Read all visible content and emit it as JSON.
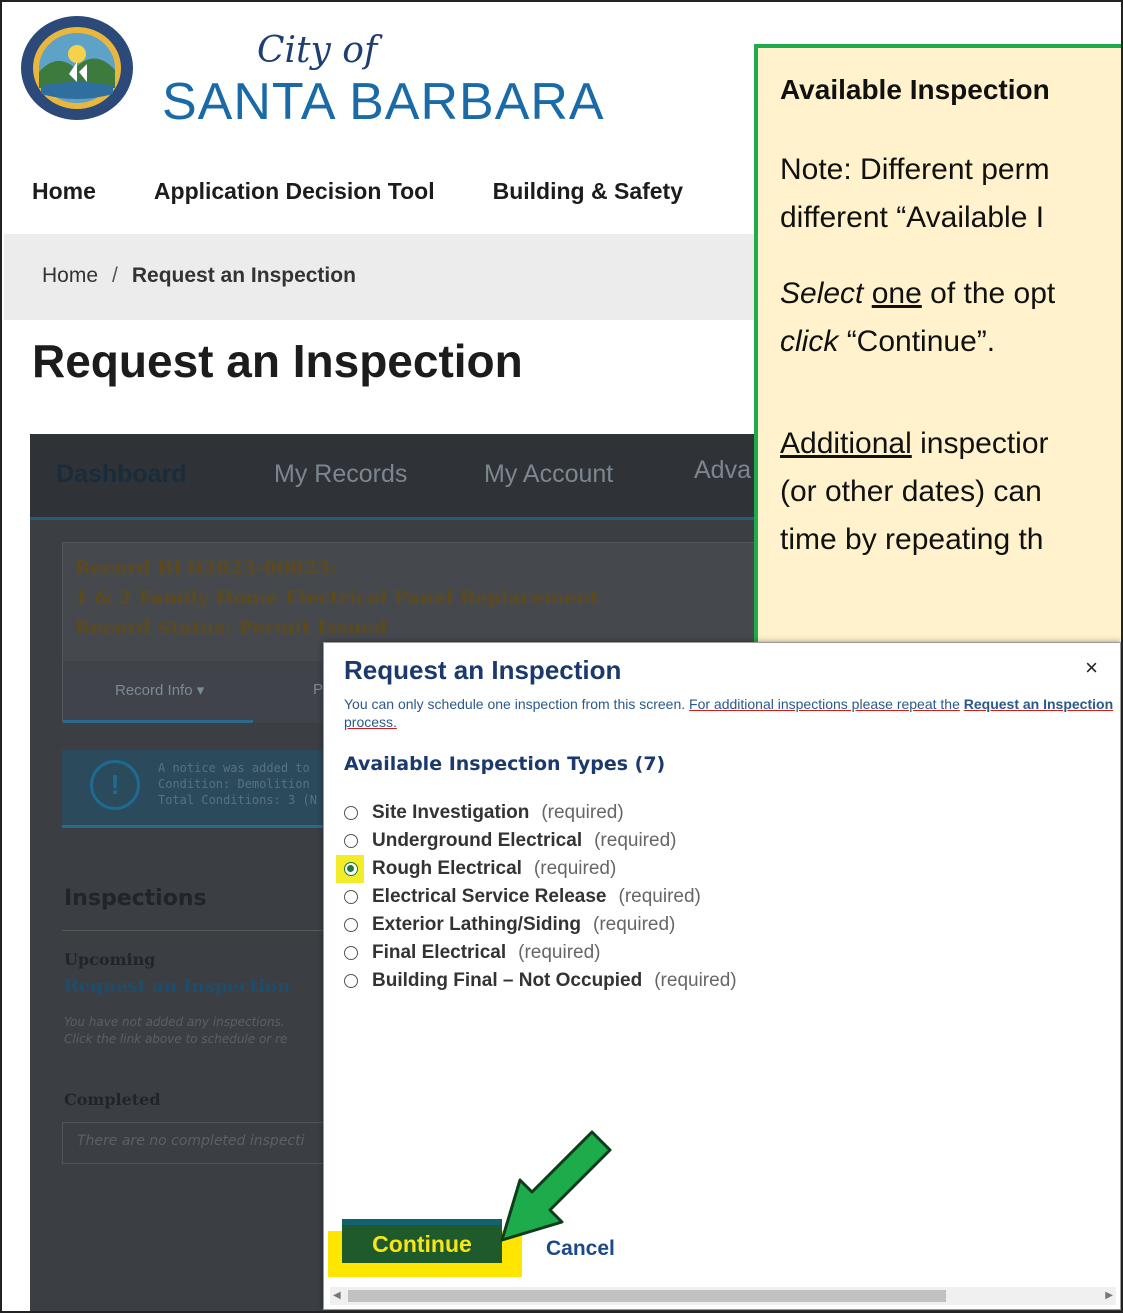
{
  "header": {
    "logo_city": "City of",
    "logo_name": "SANTA BARBARA",
    "seal_text": "SEAL OF THE CITY OF SANTA BARBARA CALIFORNIA"
  },
  "topnav": [
    "Home",
    "Application Decision Tool",
    "Building & Safety"
  ],
  "breadcrumb": {
    "home": "Home",
    "separator": "/",
    "current": "Request an Inspection"
  },
  "page_title": "Request an Inspection",
  "app": {
    "tabs": [
      "Dashboard",
      "My Records",
      "My Account",
      "Adva"
    ],
    "record": {
      "line1": "Record BLD2023-00023:",
      "line2": "1 & 2 Family Home Electrical Panel Replacement",
      "line3": "Record Status: Permit Issued",
      "tab1": "Record Info ▾",
      "tab2": "P"
    },
    "notice": {
      "line1": "A notice was added to",
      "line2": "Condition: Demolition",
      "line3": "Total Conditions: 3 (N"
    },
    "inspections": {
      "title": "Inspections",
      "upcoming": "Upcoming",
      "request_link": "Request an Inspection",
      "none_line1": "You have not added any inspections.",
      "none_line2": "Click the link above to schedule or re",
      "completed": "Completed",
      "none_completed": "There are no completed inspecti"
    }
  },
  "callout": {
    "title": "Available Inspection",
    "l1": "Note: Different perm",
    "l2": "different “Available I",
    "l3a": "Select",
    "l3b": "one",
    "l3c": "of the opt",
    "l4a": "click",
    "l4b": "“Continue”.",
    "l5a": "Additional",
    "l5b": "inspectior",
    "l6": "(or other dates) can",
    "l7": "time by repeating th",
    "border_color": "#1eab4b",
    "bg_color": "#fff2cc"
  },
  "modal": {
    "title": "Request an Inspection",
    "close": "×",
    "note_plain": "You can only schedule one inspection from this screen.",
    "note_ul": "For additional inspections please repeat the",
    "note_bold": "Request an Inspection",
    "note_end": "process.",
    "available": "Available Inspection Types (7)",
    "options": [
      {
        "label": "Site Investigation",
        "req": "(required)",
        "selected": false
      },
      {
        "label": "Underground Electrical",
        "req": "(required)",
        "selected": false
      },
      {
        "label": "Rough Electrical",
        "req": "(required)",
        "selected": true
      },
      {
        "label": "Electrical Service Release",
        "req": "(required)",
        "selected": false
      },
      {
        "label": "Exterior Lathing/Siding",
        "req": "(required)",
        "selected": false
      },
      {
        "label": "Final Electrical",
        "req": "(required)",
        "selected": false
      },
      {
        "label": "Building Final – Not Occupied",
        "req": "(required)",
        "selected": false
      }
    ],
    "continue": "Continue",
    "cancel": "Cancel"
  }
}
